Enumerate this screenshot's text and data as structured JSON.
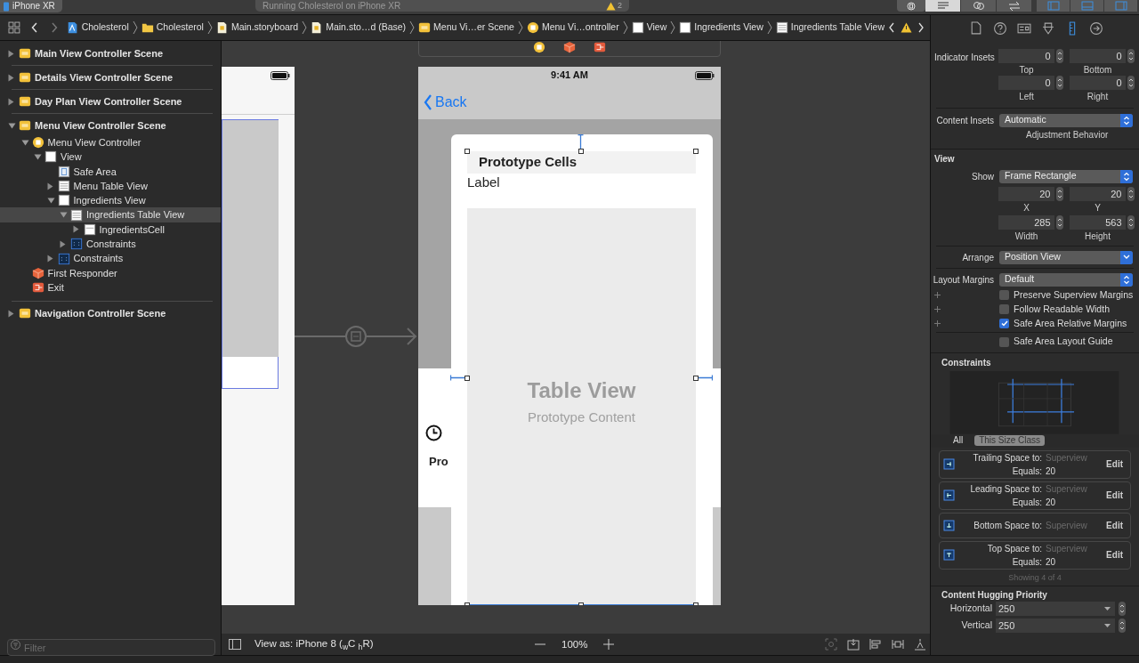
{
  "toolbar": {
    "scheme": "iPhone XR",
    "activity": "Running Cholesterol on iPhone XR",
    "warning_count": "2"
  },
  "breadcrumbs": [
    {
      "label": "Cholesterol",
      "kind": "project"
    },
    {
      "label": "Cholesterol",
      "kind": "folder"
    },
    {
      "label": "Main.storyboard",
      "kind": "storyboard"
    },
    {
      "label": "Main.sto…d (Base)",
      "kind": "storyboard"
    },
    {
      "label": "Menu Vi…er Scene",
      "kind": "scene"
    },
    {
      "label": "Menu Vi…ontroller",
      "kind": "controller"
    },
    {
      "label": "View",
      "kind": "view"
    },
    {
      "label": "Ingredients View",
      "kind": "view"
    },
    {
      "label": "Ingredients Table View",
      "kind": "table"
    }
  ],
  "inspector_tabs": [
    {
      "kind": "file",
      "selected": false
    },
    {
      "kind": "help",
      "selected": false
    },
    {
      "kind": "identity",
      "selected": false
    },
    {
      "kind": "attributes",
      "selected": false
    },
    {
      "kind": "size",
      "selected": true
    },
    {
      "kind": "connections",
      "selected": false
    }
  ],
  "outline": [
    {
      "label": "Main View Controller Scene",
      "kind": "scene",
      "expanded": false,
      "selected": false
    },
    {
      "label": "Details View Controller Scene",
      "kind": "scene",
      "expanded": false,
      "selected": false
    },
    {
      "label": "Day Plan View Controller Scene",
      "kind": "scene",
      "expanded": false,
      "selected": false
    },
    {
      "label": "Menu View Controller Scene",
      "kind": "scene",
      "expanded": true,
      "selected": false,
      "children": [
        {
          "label": "Menu View Controller",
          "kind": "controller",
          "expanded": true,
          "selected": false,
          "children": [
            {
              "label": "View",
              "kind": "view",
              "expanded": true,
              "selected": false,
              "children": [
                {
                  "label": "Safe Area",
                  "kind": "safe_area",
                  "selected": false
                },
                {
                  "label": "Menu Table View",
                  "kind": "table",
                  "expanded": false,
                  "selected": false
                },
                {
                  "label": "Ingredients View",
                  "kind": "view",
                  "expanded": true,
                  "selected": false,
                  "children": [
                    {
                      "label": "Ingredients Table View",
                      "kind": "table",
                      "expanded": true,
                      "selected": true,
                      "children": [
                        {
                          "label": "IngredientsCell",
                          "kind": "cell",
                          "expanded": false,
                          "selected": false
                        }
                      ]
                    },
                    {
                      "label": "Constraints",
                      "kind": "constraints",
                      "expanded": false,
                      "selected": false
                    }
                  ]
                },
                {
                  "label": "Constraints",
                  "kind": "constraints",
                  "expanded": false,
                  "selected": false
                }
              ]
            }
          ]
        },
        {
          "label": "First Responder",
          "kind": "responder",
          "selected": false
        },
        {
          "label": "Exit",
          "kind": "exit",
          "selected": false
        }
      ]
    },
    {
      "label": "Navigation Controller Scene",
      "kind": "scene",
      "expanded": false,
      "selected": false
    }
  ],
  "filter": {
    "placeholder": "Filter"
  },
  "phone": {
    "time": "9:41 AM",
    "back": "Back",
    "header": "Prototype Cells",
    "cell_label": "Label",
    "table_title": "Table View",
    "table_subtitle": "Prototype Content",
    "behind_text": "Pro"
  },
  "bottom_bar": {
    "view_as": "View as: iPhone 8 ($_{w}$C $_{h}$R)",
    "zoom": "100%"
  },
  "inspector": {
    "indicator_insets": {
      "label": "Indicator Insets",
      "fields": [
        {
          "value": "0",
          "caption": "Top"
        },
        {
          "value": "0",
          "caption": "Bottom"
        },
        {
          "value": "0",
          "caption": "Left"
        },
        {
          "value": "0",
          "caption": "Right"
        }
      ]
    },
    "content_insets": {
      "label": "Content Insets",
      "value": "Automatic",
      "caption": "Adjustment Behavior"
    },
    "view": {
      "title": "View",
      "show": {
        "label": "Show",
        "value": "Frame Rectangle"
      },
      "frame": [
        {
          "value": "20",
          "caption": "X"
        },
        {
          "value": "20",
          "caption": "Y"
        },
        {
          "value": "285",
          "caption": "Width"
        },
        {
          "value": "563",
          "caption": "Height"
        }
      ],
      "arrange": {
        "label": "Arrange",
        "value": "Position View"
      },
      "layout_margins": {
        "label": "Layout Margins",
        "value": "Default"
      },
      "checkboxes": [
        {
          "label": "Preserve Superview Margins",
          "checked": false,
          "plus": true
        },
        {
          "label": "Follow Readable Width",
          "checked": false,
          "plus": true
        },
        {
          "label": "Safe Area Relative Margins",
          "checked": true,
          "plus": true
        },
        {
          "label": "Safe Area Layout Guide",
          "checked": false,
          "plus": false
        }
      ]
    },
    "constraints": {
      "title": "Constraints",
      "filters": [
        {
          "label": "All",
          "selected": false
        },
        {
          "label": "This Size Class",
          "selected": true
        }
      ],
      "items": [
        {
          "kind": "trailing",
          "label": "Trailing Space to:",
          "target": "Superview",
          "equals_label": "Equals:",
          "value": "20",
          "action": "Edit"
        },
        {
          "kind": "leading",
          "label": "Leading Space to:",
          "target": "Superview",
          "equals_label": "Equals:",
          "value": "20",
          "action": "Edit"
        },
        {
          "kind": "bottom",
          "label": "Bottom Space to:",
          "target": "Superview",
          "action": "Edit"
        },
        {
          "kind": "top",
          "label": "Top Space to:",
          "target": "Superview",
          "equals_label": "Equals:",
          "value": "20",
          "action": "Edit"
        }
      ],
      "footer": "Showing 4 of 4"
    },
    "hugging": {
      "title": "Content Hugging Priority",
      "rows": [
        {
          "label": "Horizontal",
          "value": "250"
        },
        {
          "label": "Vertical",
          "value": "250"
        }
      ]
    }
  }
}
